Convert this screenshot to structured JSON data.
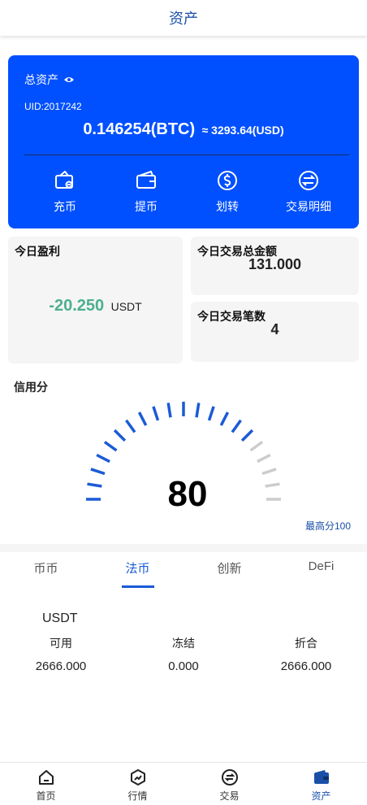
{
  "header": {
    "title": "资产"
  },
  "asset_card": {
    "label": "总资产",
    "uid": "UID:2017242",
    "btc_amount": "0.146254(BTC)",
    "usd_amount": "≈ 3293.64(USD)",
    "actions": [
      {
        "label": "充币",
        "icon": "deposit-icon"
      },
      {
        "label": "提币",
        "icon": "withdraw-icon"
      },
      {
        "label": "划转",
        "icon": "transfer-icon"
      },
      {
        "label": "交易明细",
        "icon": "transaction-details-icon"
      }
    ]
  },
  "stats": {
    "profit_title": "今日盈利",
    "profit_value": "-20.250",
    "profit_unit": "USDT",
    "total_title": "今日交易总金额",
    "total_value": "131.000",
    "count_title": "今日交易笔数",
    "count_value": "4"
  },
  "credit": {
    "label": "信用分",
    "score": "80",
    "max_label": "最高分100",
    "score_value": 80,
    "max_value": 100
  },
  "tabs": [
    {
      "label": "币币",
      "active": false
    },
    {
      "label": "法币",
      "active": true
    },
    {
      "label": "创新",
      "active": false
    },
    {
      "label": "DeFi",
      "active": false
    }
  ],
  "balance": {
    "currency": "USDT",
    "available_label": "可用",
    "available_value": "2666.000",
    "frozen_label": "冻结",
    "frozen_value": "0.000",
    "equiv_label": "折合",
    "equiv_value": "2666.000"
  },
  "tabbar": [
    {
      "label": "首页",
      "icon": "home-icon",
      "active": false
    },
    {
      "label": "行情",
      "icon": "market-icon",
      "active": false
    },
    {
      "label": "交易",
      "icon": "trade-icon",
      "active": false
    },
    {
      "label": "资产",
      "icon": "wallet-icon",
      "active": true
    }
  ],
  "colors": {
    "brand_blue": "#0050ff",
    "accent_blue": "#1a5bd6",
    "profit_green": "#4caf8f",
    "gauge_inactive": "#cccccc"
  }
}
